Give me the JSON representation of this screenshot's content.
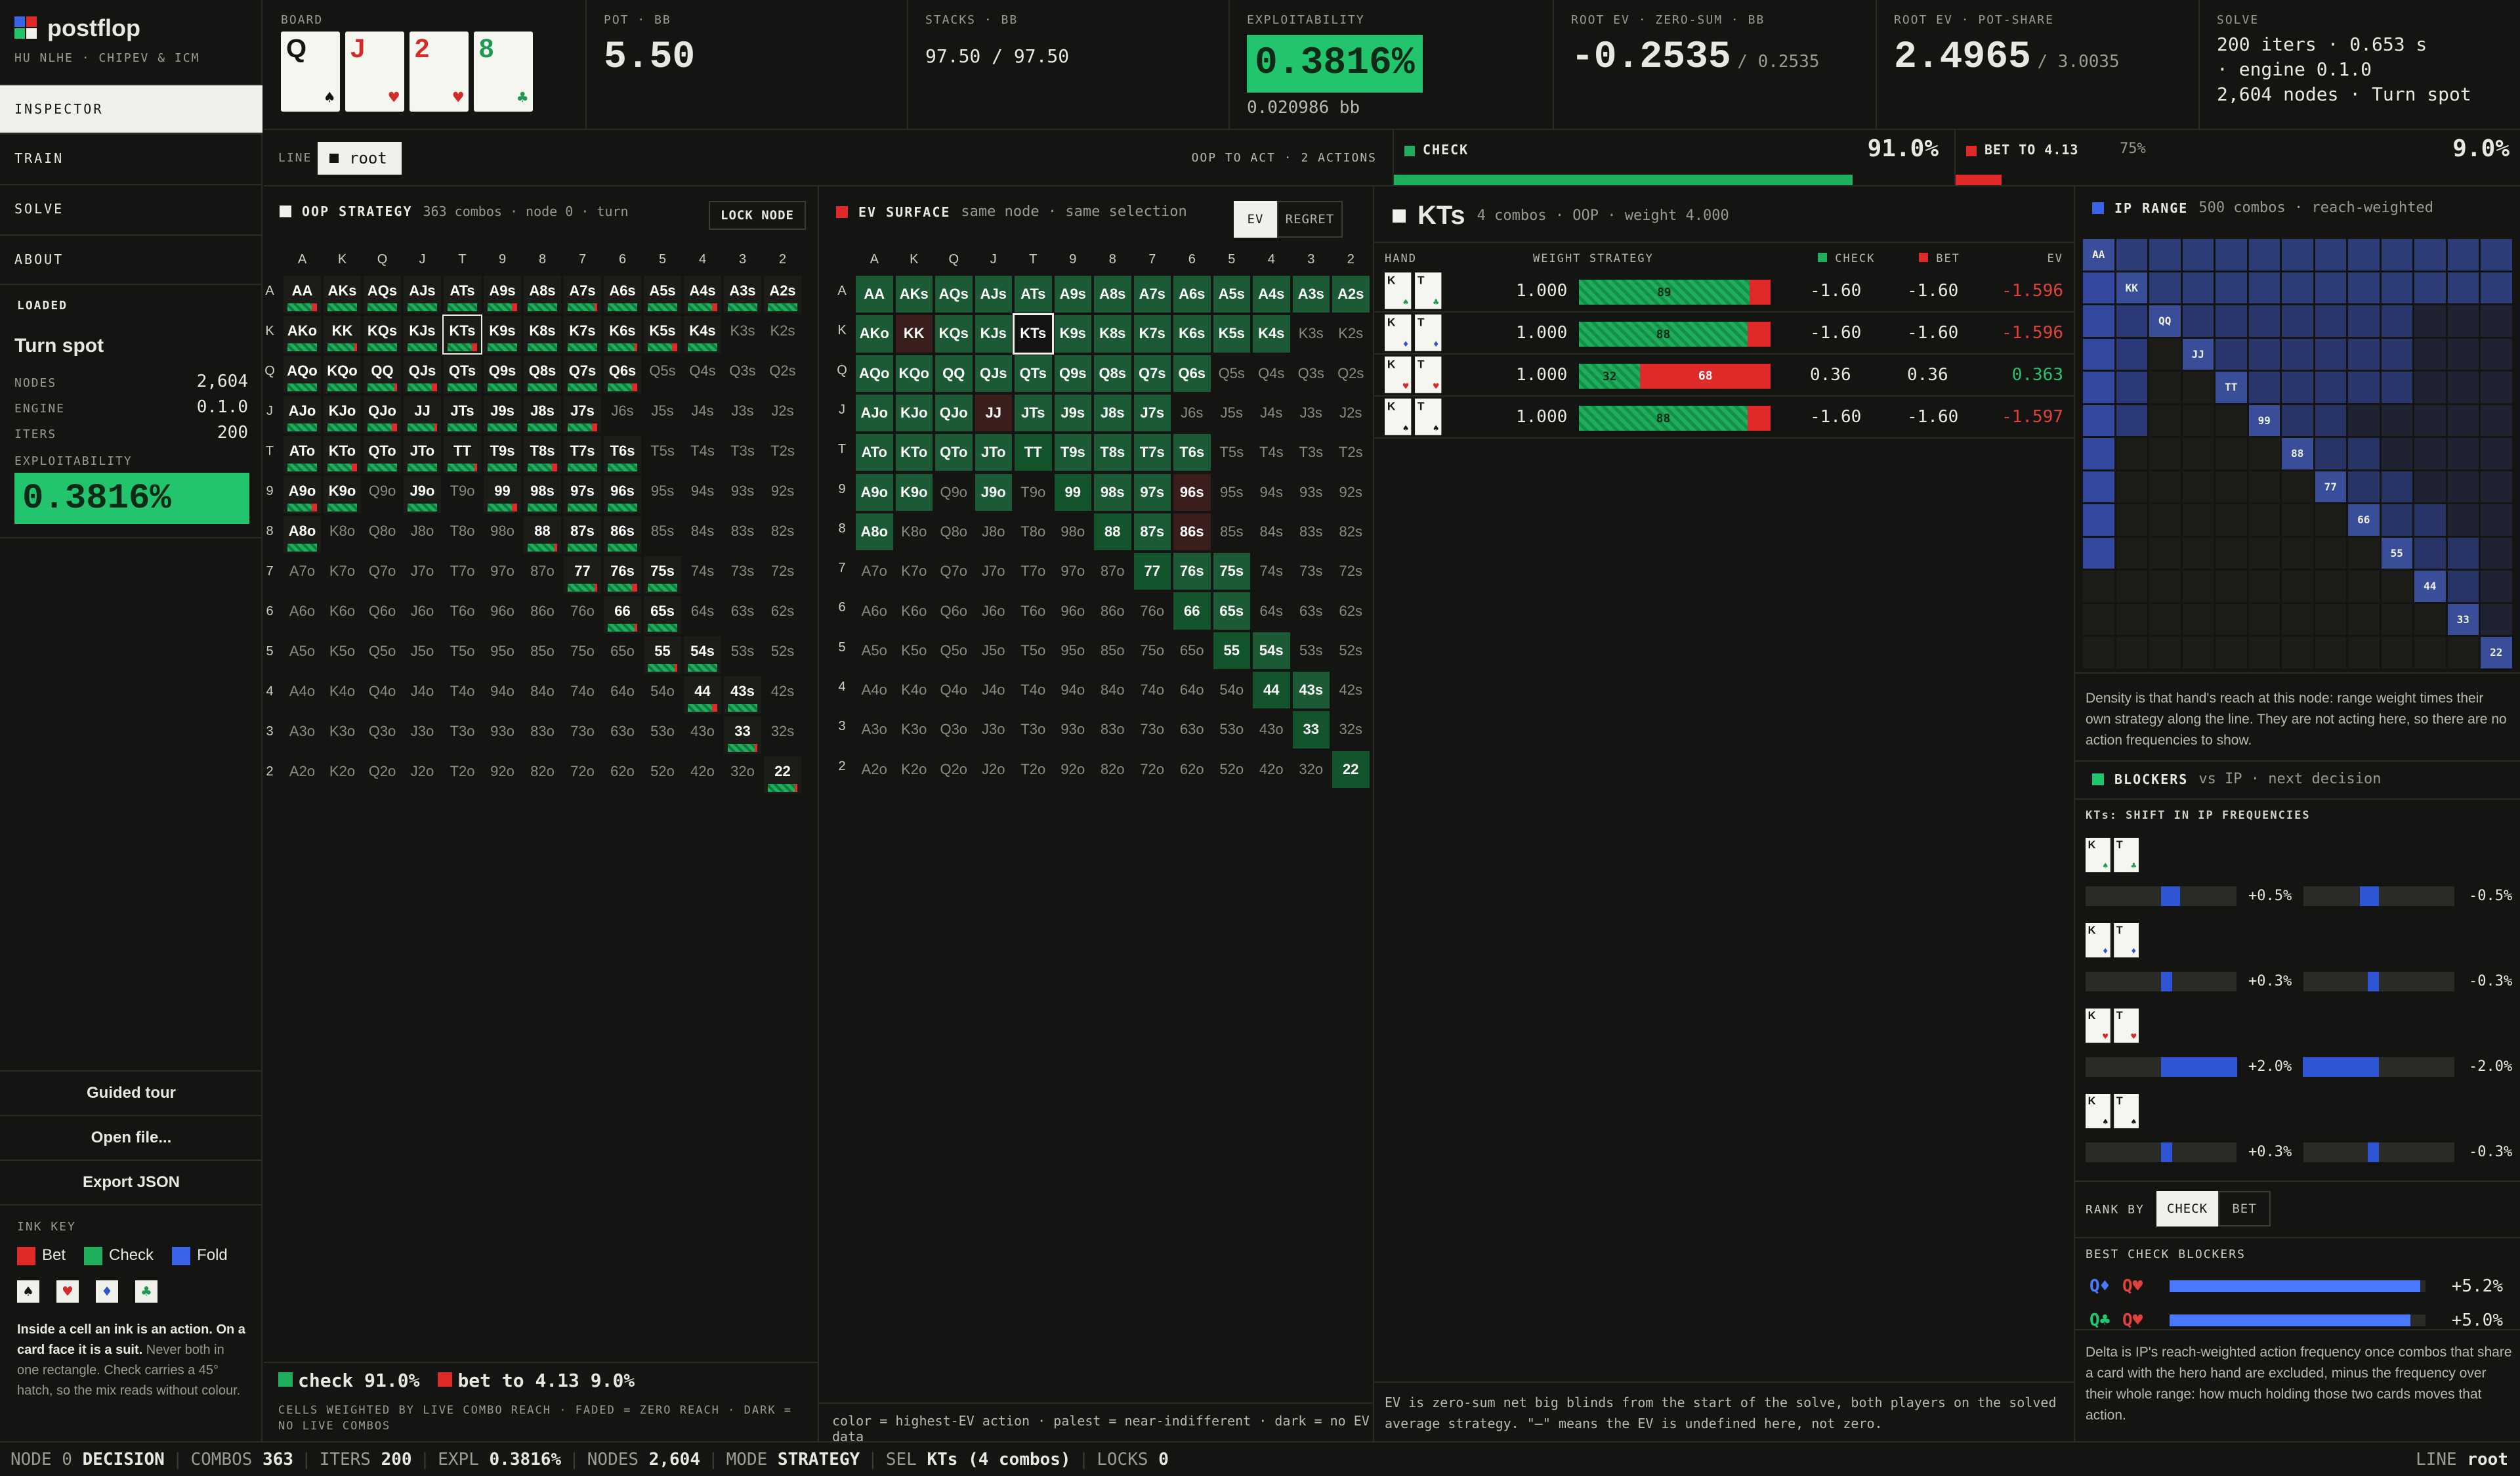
{
  "app": {
    "name": "postflop",
    "subtitle": "HU NLHE · CHIPEV & ICM"
  },
  "nav": [
    {
      "label": "INSPECTOR",
      "active": true
    },
    {
      "label": "TRAIN"
    },
    {
      "label": "SOLVE"
    },
    {
      "label": "ABOUT"
    }
  ],
  "loaded": {
    "label": "LOADED",
    "title": "Turn spot",
    "nodes_label": "NODES",
    "nodes": "2,604",
    "engine_label": "ENGINE",
    "engine": "0.1.0",
    "iters_label": "ITERS",
    "iters": "200",
    "expl_label": "EXPLOITABILITY",
    "expl": "0.3816%"
  },
  "sidebar_buttons": {
    "tour": "Guided tour",
    "open": "Open file...",
    "export": "Export JSON"
  },
  "ink_key": {
    "label": "INK KEY",
    "bet": "Bet",
    "check": "Check",
    "fold": "Fold",
    "suits": [
      "♠",
      "♥",
      "♦",
      "♣"
    ],
    "note_bold": "Inside a cell an ink is an action. On a card face it is a suit.",
    "note_rest": " Never both in one rectangle. Check carries a 45° hatch, so the mix reads without colour."
  },
  "header": {
    "board_label": "BOARD",
    "board": [
      {
        "rank": "Q",
        "suit": "♠",
        "color": "#141512"
      },
      {
        "rank": "J",
        "suit": "♥",
        "color": "#d42a2a"
      },
      {
        "rank": "2",
        "suit": "♥",
        "color": "#d42a2a"
      },
      {
        "rank": "8",
        "suit": "♣",
        "color": "#1c9a52"
      }
    ],
    "pot_label": "POT · BB",
    "pot": "5.50",
    "stacks_label": "STACKS · BB",
    "stacks": "97.50 / 97.50",
    "expl_label": "EXPLOITABILITY",
    "expl": "0.3816%",
    "expl_bb": "0.020986 bb",
    "root_ev_zs_label": "ROOT EV · ZERO-SUM · BB",
    "root_ev_zs": "-0.2535",
    "root_ev_zs_b": "/ 0.2535",
    "root_ev_ps_label": "ROOT EV · POT-SHARE",
    "root_ev_ps": "2.4965",
    "root_ev_ps_b": "/ 3.0035",
    "solve_label": "SOLVE",
    "solve_l1": "200 iters · 0.653 s",
    "solve_l2": "· engine 0.1.0",
    "solve_l3": "2,604 nodes · Turn spot"
  },
  "line": {
    "label": "LINE",
    "value": "root",
    "to_act": "OOP TO ACT · 2 ACTIONS",
    "check_label": "CHECK",
    "check_pct": "91.0%",
    "check_frac": 0.91,
    "bet_label": "BET TO 4.13",
    "bet_pct_small": "75%",
    "bet_pct": "9.0%",
    "bet_frac": 0.09
  },
  "oop": {
    "title": "OOP STRATEGY",
    "meta": "363 combos · node 0 · turn",
    "lock": "LOCK NODE",
    "legend_check": "check 91.0%",
    "legend_bet": "bet to 4.13 9.0%",
    "foot": "CELLS WEIGHTED BY LIVE COMBO REACH · FADED = ZERO REACH · DARK = NO LIVE COMBOS"
  },
  "ev": {
    "title": "EV SURFACE",
    "meta": "same node · same selection",
    "tab_ev": "EV",
    "tab_regret": "REGRET",
    "foot": "color = highest-EV action · palest = near-indifferent · dark = no EV data"
  },
  "ranks": [
    "A",
    "K",
    "Q",
    "J",
    "T",
    "9",
    "8",
    "7",
    "6",
    "5",
    "4",
    "3",
    "2"
  ],
  "hand": {
    "title": "KTs",
    "meta": "4 combos · OOP · weight 4.000",
    "cols": {
      "hand": "HAND",
      "weight": "WEIGHT",
      "strategy": "STRATEGY",
      "check": "CHECK",
      "bet": "BET",
      "ev": "EV"
    },
    "rows": [
      {
        "k": "♠",
        "kc": "#1c9a52",
        "t": "♣",
        "tc": "#1c9a52",
        "weight": "1.000",
        "check_pct": 89,
        "check_txt": "89",
        "bet_txt": "",
        "check": "-1.60",
        "bet": "-1.60",
        "ev": "-1.596",
        "evc": "#e0413c"
      },
      {
        "k": "♦",
        "kc": "#2f55d4",
        "t": "♦",
        "tc": "#2f55d4",
        "weight": "1.000",
        "check_pct": 88,
        "check_txt": "88",
        "bet_txt": "",
        "check": "-1.60",
        "bet": "-1.60",
        "ev": "-1.596",
        "evc": "#e0413c"
      },
      {
        "k": "♥",
        "kc": "#d42a2a",
        "t": "♥",
        "tc": "#d42a2a",
        "weight": "1.000",
        "check_pct": 32,
        "check_txt": "32",
        "bet_txt": "68",
        "check": "0.36",
        "bet": "0.36",
        "ev": "0.363",
        "evc": "#22c46d"
      },
      {
        "k": "♠",
        "kc": "#141512",
        "t": "♠",
        "tc": "#141512",
        "weight": "1.000",
        "check_pct": 88,
        "check_txt": "88",
        "bet_txt": "",
        "check": "-1.60",
        "bet": "-1.60",
        "ev": "-1.597",
        "evc": "#e0413c"
      }
    ],
    "foot": "EV is zero-sum net big blinds from the start of the solve, both players on the solved average strategy. \"–\" means the EV is undefined here, not zero."
  },
  "ip": {
    "title": "IP RANGE",
    "meta": "500 combos · reach-weighted",
    "note": "Density is that hand's reach at this node: range weight times their own strategy along the line. They are not acting here, so there are no action frequencies to show.",
    "diag": [
      "AA",
      "KK",
      "QQ",
      "JJ",
      "TT",
      "99",
      "88",
      "77",
      "66",
      "55",
      "44",
      "33",
      "22"
    ]
  },
  "blockers": {
    "title": "BLOCKERS",
    "meta": "vs IP · next decision",
    "sub": "KTs: SHIFT IN IP FREQUENCIES",
    "rows": [
      {
        "kc": "#1c9a52",
        "ks": "♠",
        "tc": "#1c9a52",
        "ts": "♣",
        "a": "+0.5%",
        "b": "-0.5%",
        "va": 0.5
      },
      {
        "kc": "#2f55d4",
        "ks": "♦",
        "tc": "#2f55d4",
        "ts": "♦",
        "a": "+0.3%",
        "b": "-0.3%",
        "va": 0.3
      },
      {
        "kc": "#d42a2a",
        "ks": "♥",
        "tc": "#d42a2a",
        "ts": "♥",
        "a": "+2.0%",
        "b": "-2.0%",
        "va": 2.0
      },
      {
        "kc": "#141512",
        "ks": "♠",
        "tc": "#141512",
        "ts": "♠",
        "a": "+0.3%",
        "b": "-0.3%",
        "va": 0.3
      }
    ],
    "rank_by": "RANK BY",
    "rank_check": "CHECK",
    "rank_bet": "BET",
    "best_label": "BEST CHECK BLOCKERS",
    "best": [
      {
        "c1": "Q♦",
        "c1c": "#4a78ff",
        "c2": "Q♥",
        "c2c": "#e0413c",
        "val": "+5.2%",
        "v": 5.2
      },
      {
        "c1": "Q♣",
        "c1c": "#22c46d",
        "c2": "Q♥",
        "c2c": "#e0413c",
        "val": "+5.0%",
        "v": 5.0
      }
    ],
    "foot": "Delta is IP's reach-weighted action frequency once combos that share a card with the hero hand are excluded, minus the frequency over their whole range: how much holding those two cards moves that action."
  },
  "status": {
    "node_l": "NODE",
    "node": "0",
    "node_v": "DECISION",
    "combos_l": "COMBOS",
    "combos": "363",
    "iters_l": "ITERS",
    "iters": "200",
    "expl_l": "EXPL",
    "expl": "0.3816%",
    "nodes_l": "NODES",
    "nodes": "2,604",
    "mode_l": "MODE",
    "mode": "STRATEGY",
    "sel_l": "SEL",
    "sel": "KTs (4 combos)",
    "locks_l": "LOCKS",
    "locks": "0",
    "line_l": "LINE",
    "line": "root"
  },
  "colors": {
    "accent": "#22c46d",
    "bet": "#e02a2a",
    "check": "#1fae5c",
    "fold": "#3b63e8",
    "bg": "#141512"
  }
}
